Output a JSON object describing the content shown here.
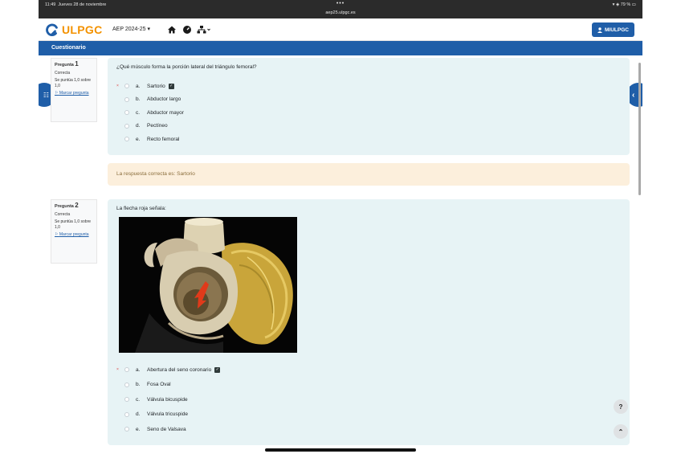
{
  "status_bar": {
    "time": "11:49",
    "date": "Jueves 28 de noviembre",
    "dots": "•••",
    "url": "aep25.ulpgc.es",
    "battery": "79 %"
  },
  "header": {
    "logo_text": "ULPGC",
    "course_menu": "AEP 2024-25",
    "profile_button": "MIULPGC",
    "icons": [
      "home-icon",
      "dashboard-icon",
      "sitemap-icon"
    ]
  },
  "page_title": "Cuestionario",
  "questions": [
    {
      "label": "Pregunta",
      "number": "1",
      "status": "Correcta",
      "score": "Se puntúa 1,0 sobre 1,0",
      "flag": "Marcar pregunta",
      "text": "¿Qué músculo forma la porción lateral del triángulo femoral?",
      "answers": [
        {
          "letter": "a.",
          "text": "Sartorio",
          "selected": true,
          "correct": true
        },
        {
          "letter": "b.",
          "text": "Abductor largo"
        },
        {
          "letter": "c.",
          "text": "Abductor mayor"
        },
        {
          "letter": "d.",
          "text": "Pectíneo"
        },
        {
          "letter": "e.",
          "text": "Recto femoral"
        }
      ],
      "feedback": "La respuesta correcta es: Sartorio"
    },
    {
      "label": "Pregunta",
      "number": "2",
      "status": "Correcta",
      "score": "Se puntúa 1,0 sobre 1,0",
      "flag": "Marcar pregunta",
      "text": "La flecha roja señala:",
      "answers": [
        {
          "letter": "a.",
          "text": "Abertura del seno coronario",
          "selected": true,
          "correct": true
        },
        {
          "letter": "b.",
          "text": "Fosa Oval"
        },
        {
          "letter": "c.",
          "text": "Válvula bicuspide"
        },
        {
          "letter": "d.",
          "text": "Válvula tricuspide"
        },
        {
          "letter": "e.",
          "text": "Seno de Valsava"
        }
      ]
    }
  ],
  "help_button": "?",
  "colors": {
    "brand_blue": "#1f5ea8",
    "brand_orange": "#f39200",
    "question_bg": "#e7f3f5",
    "feedback_bg": "#fcefdc"
  }
}
